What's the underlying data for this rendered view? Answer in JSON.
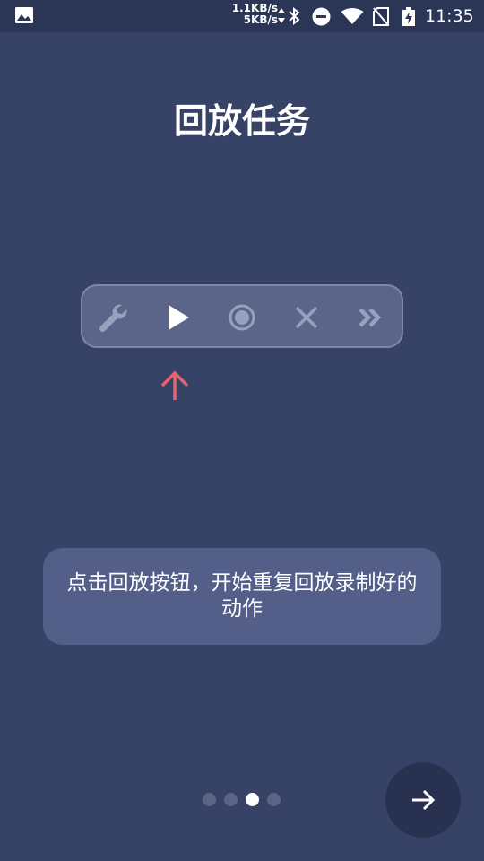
{
  "status_bar": {
    "net_up": "1.1KB/s",
    "net_down": "5KB/s",
    "time": "11:35",
    "icons": [
      "gallery-icon",
      "data-arrows-icon",
      "bluetooth-icon",
      "do-not-disturb-icon",
      "wifi-icon",
      "no-sim-icon",
      "battery-charging-icon"
    ]
  },
  "page": {
    "title": "回放任务"
  },
  "toolbar": {
    "buttons": [
      "wrench-icon",
      "play-icon",
      "record-icon",
      "close-icon",
      "fast-forward-icon"
    ],
    "highlighted": "play-icon"
  },
  "hint_arrow_color": "#e8636b",
  "tip": {
    "text": "点击回放按钮，开始重复回放录制好的动作"
  },
  "pager": {
    "total": 4,
    "current": 3
  },
  "colors": {
    "background": "#364266",
    "toolbar": "#5a6589",
    "tip_card": "#535f88",
    "next_button": "#28314f"
  }
}
